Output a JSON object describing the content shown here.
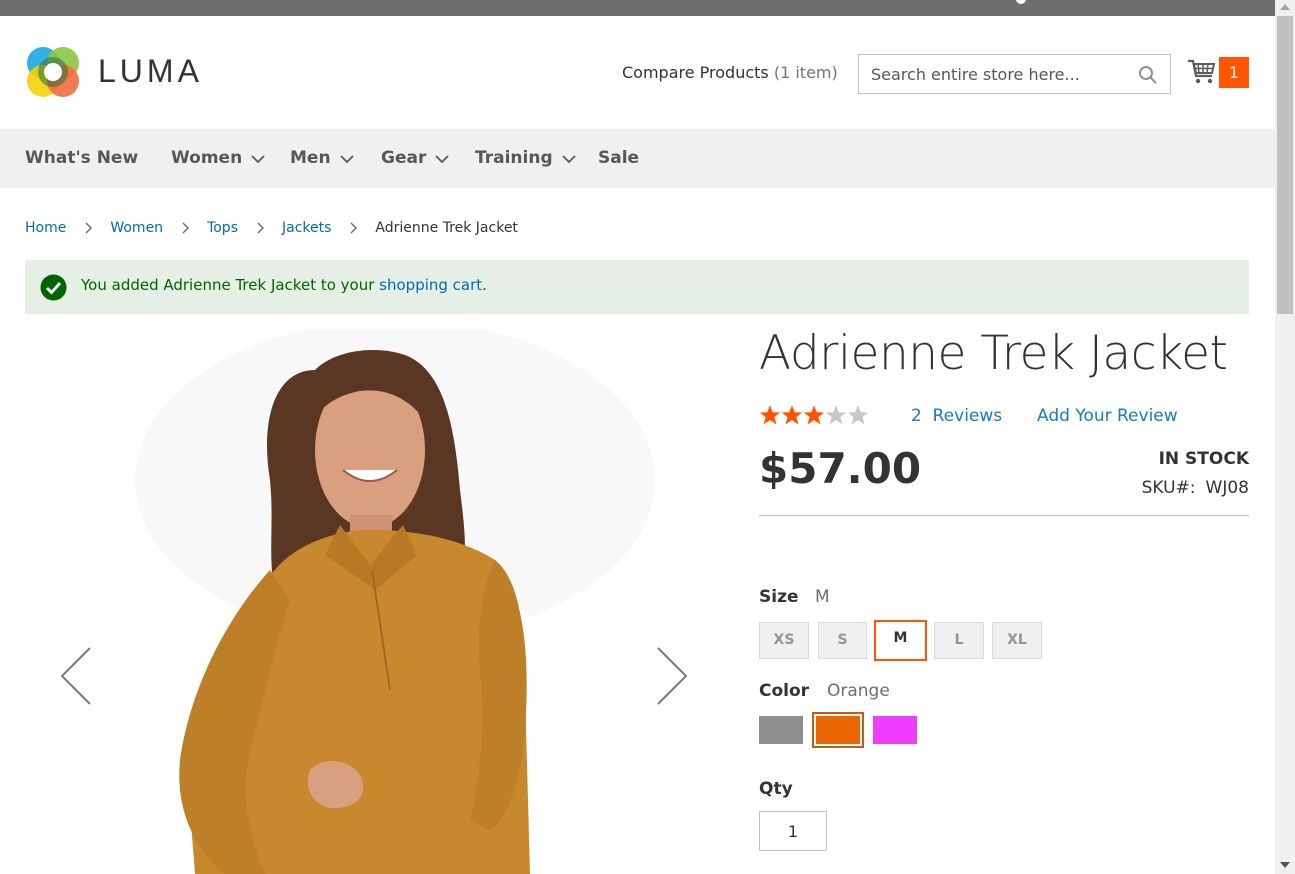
{
  "header": {
    "logo_text": "LUMA",
    "compare_label": "Compare Products",
    "compare_count": "(1 item)",
    "search_placeholder": "Search entire store here...",
    "cart_count": "1"
  },
  "nav": {
    "items": [
      {
        "label": "What's New",
        "has_dropdown": false
      },
      {
        "label": "Women",
        "has_dropdown": true
      },
      {
        "label": "Men",
        "has_dropdown": true
      },
      {
        "label": "Gear",
        "has_dropdown": true
      },
      {
        "label": "Training",
        "has_dropdown": true
      },
      {
        "label": "Sale",
        "has_dropdown": false
      }
    ]
  },
  "breadcrumb": {
    "items": [
      "Home",
      "Women",
      "Tops",
      "Jackets"
    ],
    "current": "Adrienne Trek Jacket"
  },
  "message": {
    "prefix": "You added Adrienne Trek Jacket to your ",
    "link": "shopping cart",
    "suffix": "."
  },
  "product": {
    "title": "Adrienne Trek Jacket",
    "rating_stars": 3,
    "rating_max": 5,
    "reviews_link": "2  Reviews",
    "add_review_link": "Add Your Review",
    "price": "$57.00",
    "stock": "In stock",
    "sku_label": "SKU#:",
    "sku": "WJ08"
  },
  "options": {
    "size_label": "Size",
    "size_selected": "M",
    "sizes": [
      "XS",
      "S",
      "M",
      "L",
      "XL"
    ],
    "color_label": "Color",
    "color_selected": "Orange",
    "colors": [
      {
        "name": "Gray",
        "hex": "#8f8f8f"
      },
      {
        "name": "Orange",
        "hex": "#eb6703"
      },
      {
        "name": "Purple",
        "hex": "#ef3dff"
      }
    ],
    "qty_label": "Qty",
    "qty_value": "1"
  },
  "colors": {
    "accent": "#ff5501",
    "link": "#1979c3",
    "success_bg": "#e5efe5",
    "success_text": "#006400",
    "star_on": "#ff5501",
    "star_off": "#c7c7c7"
  }
}
